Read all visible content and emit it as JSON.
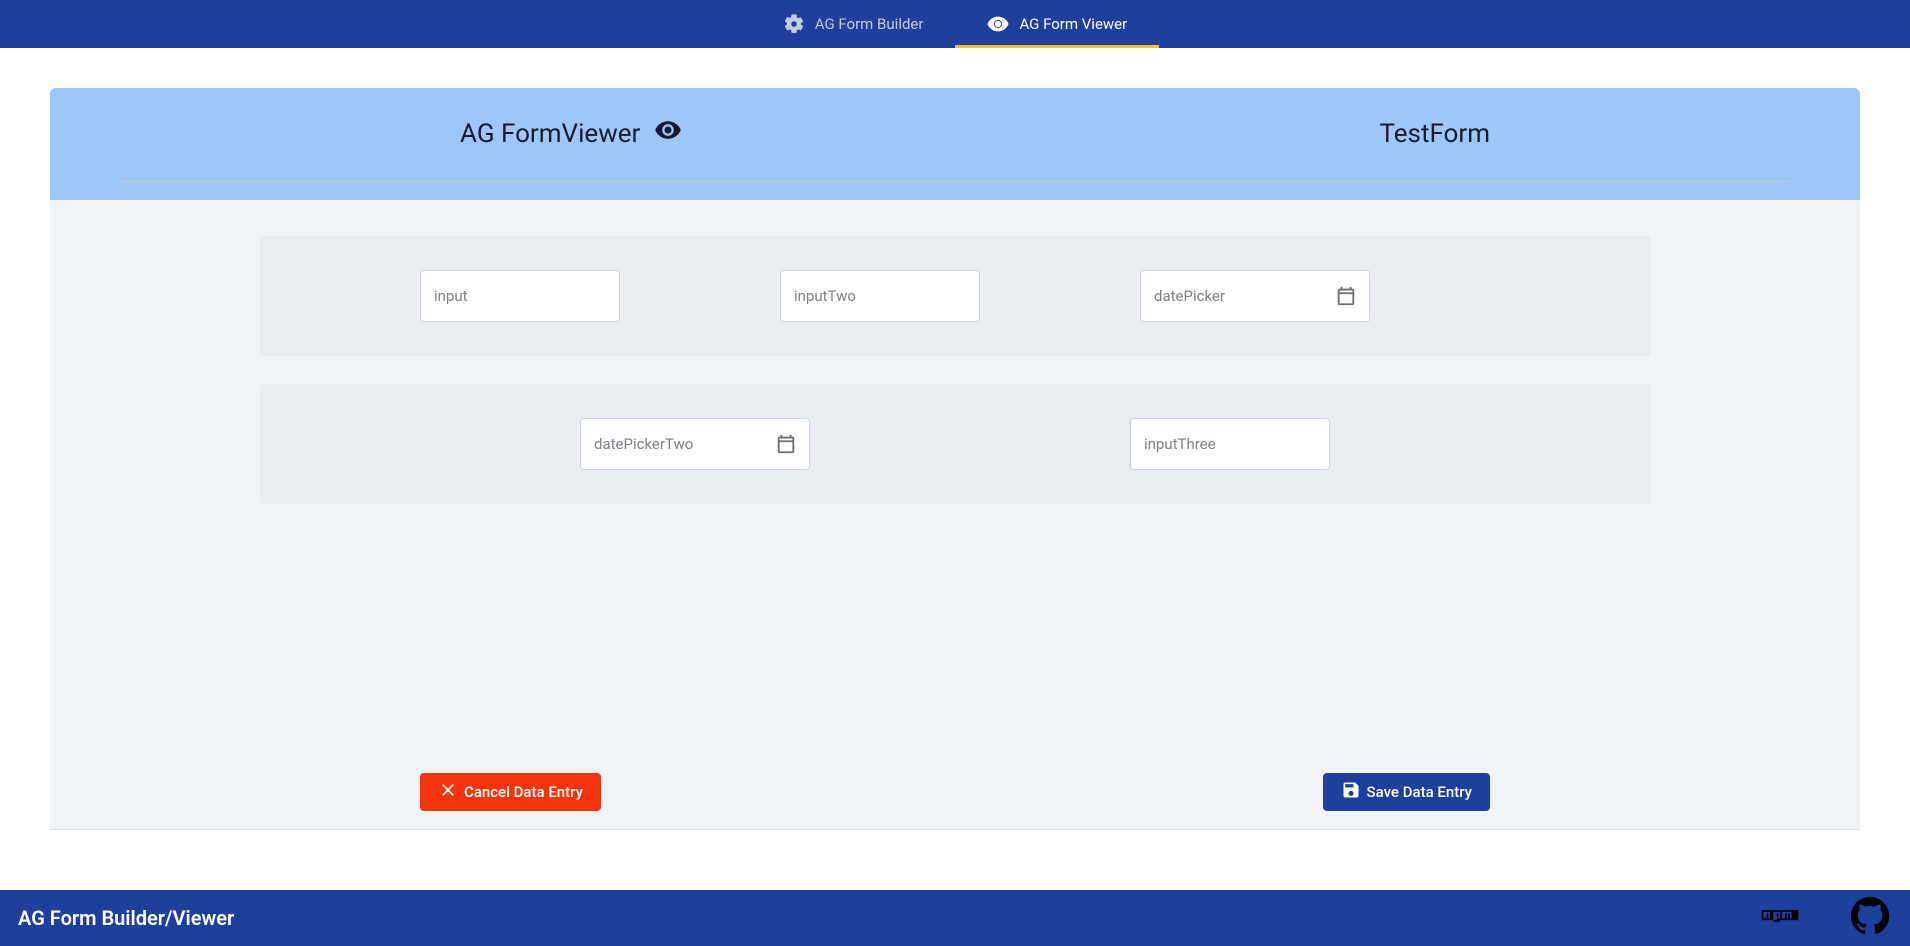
{
  "header": {
    "tabs": [
      {
        "id": "builder",
        "label": "AG Form Builder",
        "icon": "gear"
      },
      {
        "id": "viewer",
        "label": "AG Form Viewer",
        "icon": "eye",
        "active": true
      }
    ]
  },
  "card": {
    "title": "AG FormViewer",
    "form_name": "TestForm"
  },
  "fields": {
    "row1": [
      {
        "name": "input",
        "label": "input",
        "type": "text"
      },
      {
        "name": "inputTwo",
        "label": "inputTwo",
        "type": "text"
      },
      {
        "name": "datePicker",
        "label": "datePicker",
        "type": "date"
      }
    ],
    "row2": [
      {
        "name": "datePickerTwo",
        "label": "datePickerTwo",
        "type": "date"
      },
      {
        "name": "inputThree",
        "label": "inputThree",
        "type": "text"
      }
    ]
  },
  "actions": {
    "cancel": "Cancel Data Entry",
    "save": "Save Data Entry"
  },
  "footer": {
    "brand": "AG Form Builder/Viewer"
  }
}
